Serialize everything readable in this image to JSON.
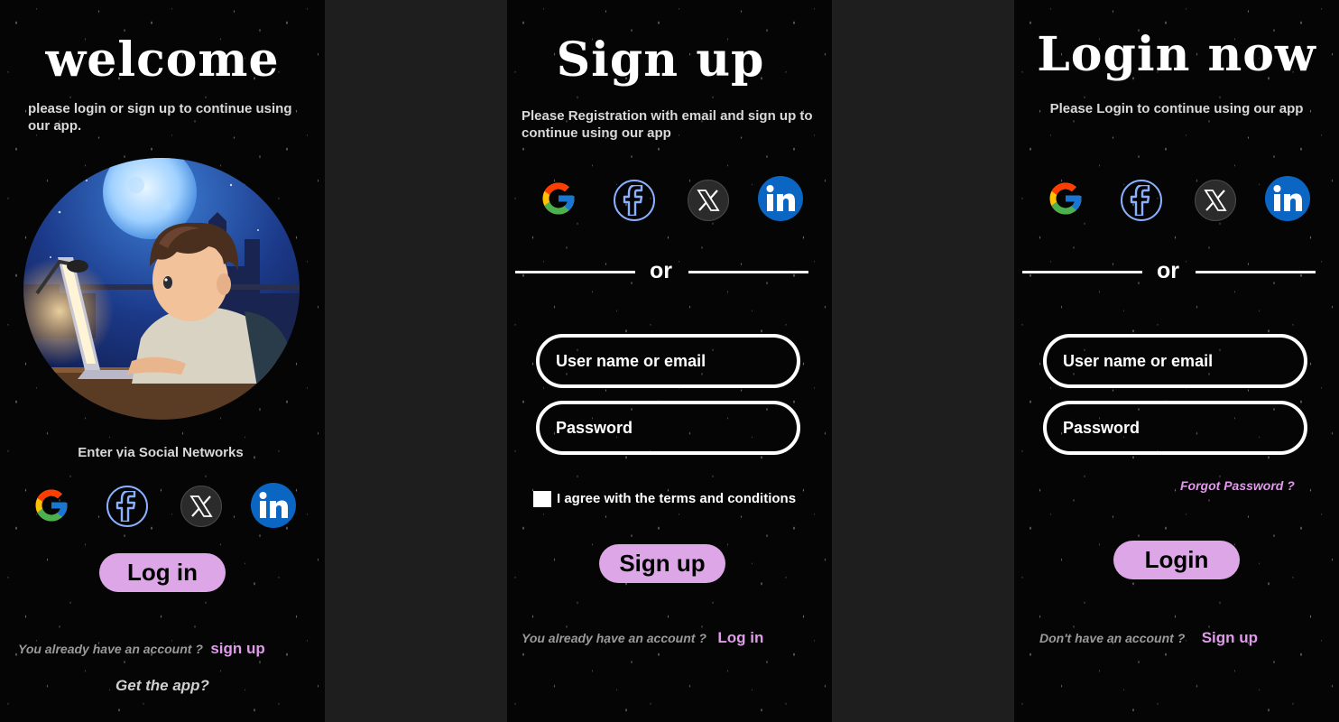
{
  "welcome": {
    "title": "welcome",
    "subtitle": "please login or sign up to continue using our app.",
    "social_label": "Enter via Social Networks",
    "login_button": "Log in",
    "account_prompt": "You already have an account ?",
    "signup_link": "sign up",
    "get_app": "Get the app?"
  },
  "signup": {
    "title": "Sign up",
    "subtitle": "Please Registration with email and sign up to continue using our app",
    "divider": "or",
    "username_placeholder": "User name or email",
    "password_placeholder": "Password",
    "terms_label": "I agree with the terms and conditions",
    "signup_button": "Sign up",
    "account_prompt": "You already have an account ?",
    "login_link": "Log in"
  },
  "login": {
    "title": "Login now",
    "subtitle": "Please Login to continue using our app",
    "divider": "or",
    "username_placeholder": "User name or email",
    "password_placeholder": "Password",
    "forgot": "Forgot Password ?",
    "login_button": "Login",
    "account_prompt": "Don't have an account ?",
    "signup_link": "Sign up"
  },
  "social_icons": [
    "google-icon",
    "facebook-icon",
    "x-icon",
    "linkedin-icon"
  ],
  "colors": {
    "accent_pink": "#dda6e6",
    "link_pink": "#e09bea",
    "background": "#050505",
    "linkedin_blue": "#0a66c2",
    "facebook_ring": "#8ab0ff"
  }
}
